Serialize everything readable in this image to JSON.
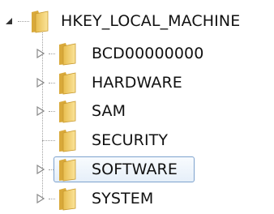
{
  "registry_tree": {
    "root": {
      "label": "HKEY_LOCAL_MACHINE",
      "expanded": true,
      "icon": "folder-icon",
      "expander_icon": "expanded-triangle-icon"
    },
    "children": [
      {
        "label": "BCD00000000",
        "icon": "folder-icon",
        "expander_icon": "collapsed-triangle-icon",
        "has_children": true
      },
      {
        "label": "HARDWARE",
        "icon": "folder-icon",
        "expander_icon": "collapsed-triangle-icon",
        "has_children": true
      },
      {
        "label": "SAM",
        "icon": "folder-icon",
        "expander_icon": "collapsed-triangle-icon",
        "has_children": true
      },
      {
        "label": "SECURITY",
        "icon": "folder-icon",
        "has_children": false
      },
      {
        "label": "SOFTWARE",
        "icon": "folder-icon",
        "expander_icon": "collapsed-triangle-icon",
        "has_children": true,
        "selected": true
      },
      {
        "label": "SYSTEM",
        "icon": "folder-icon",
        "expander_icon": "collapsed-triangle-icon",
        "has_children": true
      }
    ],
    "colors": {
      "folder_light": "#f9dc7e",
      "folder_dark": "#e0b243",
      "selection_border": "#7da2ce",
      "tree_lines": "#a0a0a0"
    }
  }
}
